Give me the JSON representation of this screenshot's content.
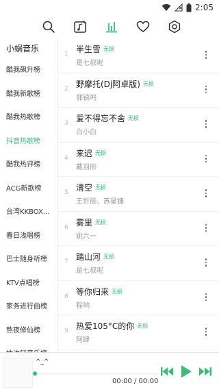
{
  "status_bar": {
    "time": "2:05"
  },
  "nav": {
    "icons": [
      "search-icon",
      "music-note-icon",
      "chart-icon",
      "heart-icon",
      "settings-icon"
    ],
    "active": "chart-icon"
  },
  "sidebar": {
    "title": "小蜗音乐",
    "items": [
      {
        "label": "酷我飙升榜"
      },
      {
        "label": "酷我新歌榜"
      },
      {
        "label": "酷我热歌榜"
      },
      {
        "label": "抖音热歌榜",
        "active": true
      },
      {
        "label": "酷我热评榜"
      },
      {
        "label": "ACG新歌榜"
      },
      {
        "label": "台湾KKBOX..."
      },
      {
        "label": "春日浅唱榜"
      },
      {
        "label": "巴士随身听榜"
      },
      {
        "label": "KTV点唱榜"
      },
      {
        "label": "家务进行曲榜"
      },
      {
        "label": "熬夜修仙榜"
      },
      {
        "label": "枕边轻音乐榜"
      }
    ]
  },
  "songs": [
    {
      "index": "1",
      "title": "半生雪",
      "tag": "无损",
      "artist": "是七叔呢"
    },
    {
      "index": "2",
      "title": "野摩托(Dj阿卓版)",
      "tag": "无损",
      "artist": "郭镐鸣"
    },
    {
      "index": "3",
      "title": "爱不得忘不舍",
      "tag": "无损",
      "artist": "白小白"
    },
    {
      "index": "4",
      "title": "来迟",
      "tag": "无损",
      "artist": "戴羽彤"
    },
    {
      "index": "5",
      "title": "清空",
      "tag": "无损",
      "artist": "王忻辰、苏星婕"
    },
    {
      "index": "6",
      "title": "雾里",
      "tag": "无损",
      "artist": "姚六一"
    },
    {
      "index": "7",
      "title": "踏山河",
      "tag": "无损",
      "artist": "是七叔呢"
    },
    {
      "index": "8",
      "title": "等你归来",
      "tag": "无损",
      "artist": "程响"
    },
    {
      "index": "9",
      "title": "热爱105°C的你",
      "tag": "无损",
      "artist": "阿肆"
    }
  ],
  "player": {
    "track": "^_^",
    "time": "00:00 / 00:00",
    "progress": 0
  },
  "colors": {
    "accent": "#3cba7a"
  }
}
